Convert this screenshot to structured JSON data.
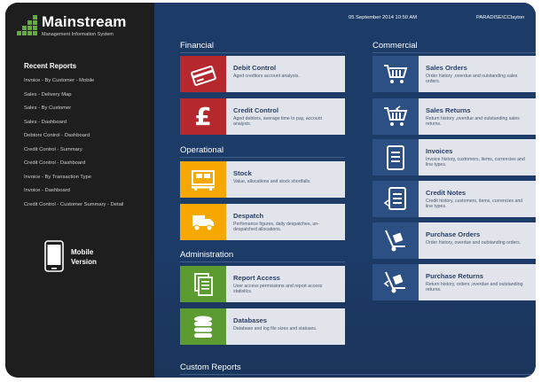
{
  "app": {
    "name": "Mainstream",
    "subtitle": "Management Information System"
  },
  "sidebar": {
    "recent_title": "Recent Reports",
    "items": [
      "Invoice - By Customer - Mobile",
      "Sales - Delivery Map",
      "Sales - By Customer",
      "Sales - Dashboard",
      "Debtors Control - Dashboard",
      "Credit Control - Summary",
      "Credit Control - Dashboard",
      "Invoice - By Transaction Type",
      "Invoice - Dashboard",
      "Credit Control - Customer Summary - Detail"
    ],
    "mobile_label_1": "Mobile",
    "mobile_label_2": "Version"
  },
  "header": {
    "datetime": "05 September 2014 10:50 AM",
    "user": "PARADISE\\CClayton"
  },
  "sections": {
    "financial": "Financial",
    "operational": "Operational",
    "administration": "Administration",
    "commercial": "Commercial",
    "custom": "Custom Reports"
  },
  "tiles": {
    "debit_control": {
      "title": "Debit Control",
      "desc": "Aged creditors account analysis."
    },
    "credit_control": {
      "title": "Credit Control",
      "desc": "Aged debtors, average time to pay, account analysis."
    },
    "stock": {
      "title": "Stock",
      "desc": "Value, allocations and stock shortfalls."
    },
    "despatch": {
      "title": "Despatch",
      "desc": "Perfomance figures, daily despatches, un-despatched allocations."
    },
    "report_access": {
      "title": "Report Access",
      "desc": "User access permissions and report access statistics."
    },
    "databases": {
      "title": "Databases",
      "desc": "Database and log file sizes and statuses."
    },
    "sales_orders": {
      "title": "Sales Orders",
      "desc": "Order history ,overdue and outstanding sales orders."
    },
    "sales_returns": {
      "title": "Sales Returns",
      "desc": "Return history ,overdue and outstanding sales returns."
    },
    "invoices": {
      "title": "Invoices",
      "desc": "Invoice history, customers, items, currencies and line types."
    },
    "credit_notes": {
      "title": "Credit Notes",
      "desc": "Credit history, customers, items, currencies and line types."
    },
    "purchase_orders": {
      "title": "Purchase Orders",
      "desc": "Order history, overdue and outstanding orders."
    },
    "purchase_returns": {
      "title": "Purchase Returns",
      "desc": "Return history, orders ,overdue and outstanding returns."
    }
  },
  "colors": {
    "financial": "#b5282d",
    "operational": "#f6a800",
    "administration": "#5c9a32",
    "commercial": "#2c4f84",
    "background": "#1c3b66"
  },
  "icons": {
    "debit_control": "card-icon",
    "credit_control": "pound-icon",
    "stock": "pallet-icon",
    "despatch": "truck-icon",
    "report_access": "documents-icon",
    "databases": "database-icon",
    "sales_orders": "cart-icon",
    "sales_returns": "cart-return-icon",
    "invoices": "invoice-icon",
    "credit_notes": "credit-note-icon",
    "purchase_orders": "trolley-icon",
    "purchase_returns": "trolley-return-icon"
  }
}
